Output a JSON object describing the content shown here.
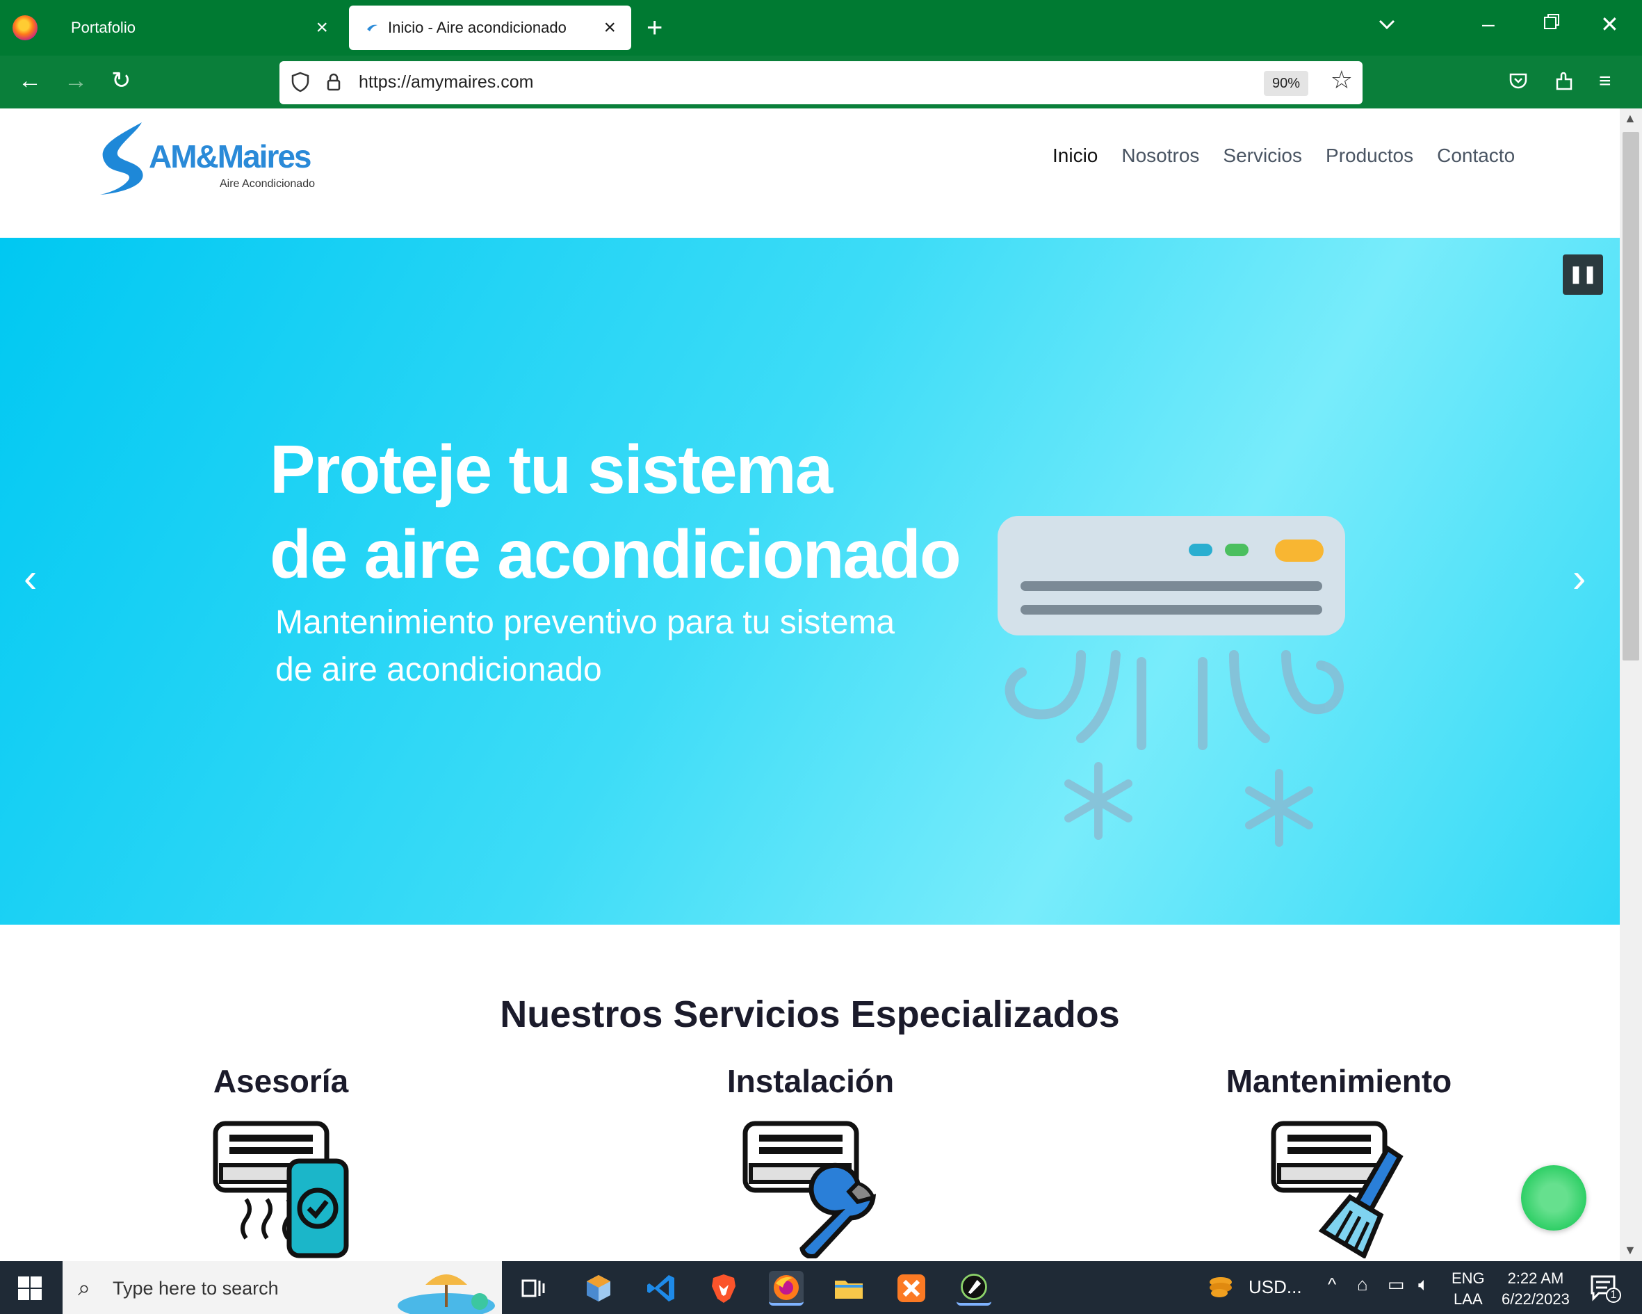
{
  "browser": {
    "tabs": [
      {
        "title": "Portafolio",
        "active": false
      },
      {
        "title": "Inicio - Aire acondicionado",
        "active": true
      }
    ],
    "url": "https://amymaires.com",
    "zoom": "90%"
  },
  "site": {
    "logo": {
      "name": "AM&Maires",
      "tagline": "Aire Acondicionado"
    },
    "menu": [
      "Inicio",
      "Nosotros",
      "Servicios",
      "Productos",
      "Contacto"
    ],
    "active_menu": "Inicio",
    "hero": {
      "title_line1": "Proteje tu sistema",
      "title_line2": "de aire acondicionado",
      "subtitle_line1": "Mantenimiento preventivo para tu sistema",
      "subtitle_line2": "de aire acondicionado"
    },
    "services": {
      "title": "Nuestros Servicios Especializados",
      "items": [
        {
          "title": "Asesoría",
          "icon": "ac-phone-icon"
        },
        {
          "title": "Instalación",
          "icon": "ac-wrench-icon"
        },
        {
          "title": "Mantenimiento",
          "icon": "ac-brush-icon"
        }
      ]
    }
  },
  "taskbar": {
    "search_placeholder": "Type here to search",
    "weather": "USD...",
    "lang_top": "ENG",
    "lang_bottom": "LAA",
    "time": "2:22 AM",
    "date": "6/22/2023",
    "notifications": "1"
  },
  "colors": {
    "tabbar": "#007a32",
    "hero_start": "#00c8f2",
    "hero_end": "#78ecfb",
    "chat": "#2fcf66"
  }
}
